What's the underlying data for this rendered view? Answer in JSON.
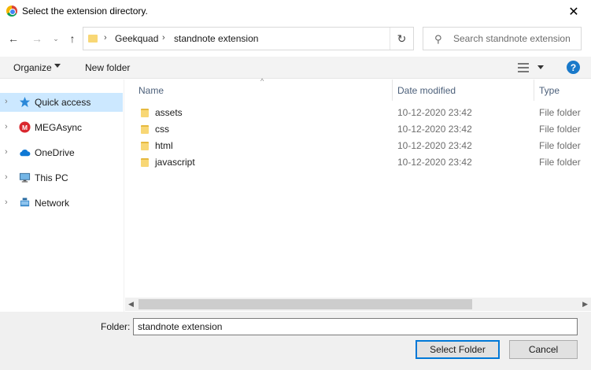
{
  "window": {
    "title": "Select the extension directory.",
    "close_glyph": "✕"
  },
  "navigation": {
    "back_glyph": "←",
    "forward_glyph": "→",
    "recent_glyph": "⌄",
    "up_glyph": "↑",
    "breadcrumb": [
      "Geekquad",
      "standnote extension"
    ],
    "separator_glyph": "›",
    "refresh_glyph": "↻"
  },
  "search": {
    "placeholder": "Search standnote extension",
    "icon": "search-icon"
  },
  "toolbar": {
    "organize_label": "Organize",
    "new_folder_label": "New folder",
    "help_glyph": "?"
  },
  "nav_pane": {
    "items": [
      {
        "label": "Quick access",
        "icon": "star-icon",
        "selected": true
      },
      {
        "label": "MEGAsync",
        "icon": "mega-icon",
        "selected": false
      },
      {
        "label": "OneDrive",
        "icon": "cloud-icon",
        "selected": false
      },
      {
        "label": "This PC",
        "icon": "computer-icon",
        "selected": false
      },
      {
        "label": "Network",
        "icon": "network-icon",
        "selected": false
      }
    ]
  },
  "file_list": {
    "columns": {
      "name": "Name",
      "date": "Date modified",
      "type": "Type"
    },
    "rows": [
      {
        "name": "assets",
        "date": "10-12-2020 23:42",
        "type": "File folder"
      },
      {
        "name": "css",
        "date": "10-12-2020 23:42",
        "type": "File folder"
      },
      {
        "name": "html",
        "date": "10-12-2020 23:42",
        "type": "File folder"
      },
      {
        "name": "javascript",
        "date": "10-12-2020 23:42",
        "type": "File folder"
      }
    ]
  },
  "footer": {
    "folder_label": "Folder:",
    "folder_value": "standnote extension",
    "select_button": "Select Folder",
    "cancel_button": "Cancel"
  },
  "colors": {
    "selection": "#cce8ff",
    "accent": "#0078d7",
    "folder": "#f8d775",
    "mega": "#d9272e",
    "onedrive": "#0f78d4",
    "help": "#1979ca"
  }
}
